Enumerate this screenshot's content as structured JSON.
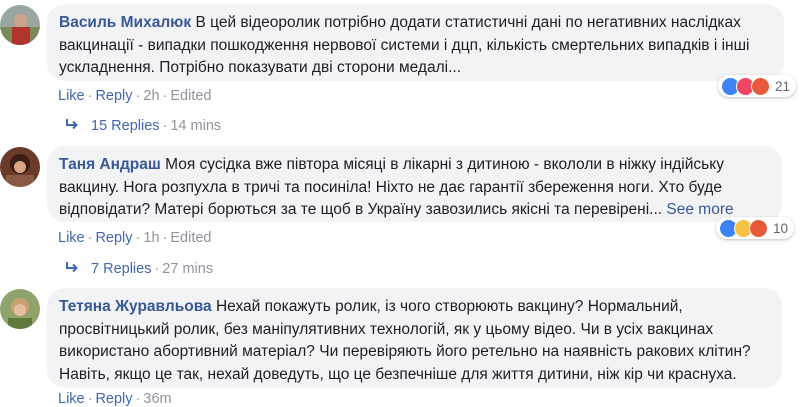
{
  "comments": [
    {
      "author": "Василь Михалюк",
      "text": "В цей відеоролик потрібно додати статистичні дані по негативних наслідках вакцинації - випадки пошкодження нервової системи і дцп, кількість смертельних випадків і інші ускладнення. Потрібно показувати дві сторони медалі...",
      "like": "Like",
      "reply": "Reply",
      "time": "2h",
      "edited": "Edited",
      "reaction_count": "21",
      "reaction_icons": [
        "like-icon",
        "love-icon",
        "angry-icon"
      ],
      "replies_label": "15 Replies",
      "replies_time": "14 mins"
    },
    {
      "author": "Таня Андраш",
      "text": "Моя сусідка вже півтора місяці в лікарні з дитиною - вкололи в ніжку індійську вакцину. Нога розпухла в тричі та посинілa! Ніхто не дає гарантії збереження ноги. Хто буде відповідати? Матері борються за те щоб в Україну завозились якісні та перевірені...",
      "see_more": "See more",
      "like": "Like",
      "reply": "Reply",
      "time": "1h",
      "edited": "Edited",
      "reaction_count": "10",
      "reaction_icons": [
        "like-icon",
        "sad-icon",
        "angry-icon"
      ],
      "replies_label": "7 Replies",
      "replies_time": "27 mins"
    },
    {
      "author": "Тетяна Журавльова",
      "text": "Нехай покажуть ролик, із чого створюють вакцину? Нормальний, просвітницький ролик, без маніпулятивних технологій, як у цьому відео. Чи в усіх вакцинах використано абортивний матеріал? Чи перевіряють його ретельно на наявність ракових клітин? Навіть, якщо це так, нехай доведуть, що це безпечніше для життя дитини, ніж кір чи краснуха.",
      "like": "Like",
      "reply": "Reply",
      "time": "36m"
    }
  ],
  "colors": {
    "link": "#4267b2",
    "author": "#385898",
    "bubble": "#f2f3f5",
    "muted": "#90949c",
    "like_blue": "#3b83f7",
    "love_red": "#f0465f",
    "angry_orange": "#e8593a",
    "sad_yellow": "#f7c244"
  }
}
